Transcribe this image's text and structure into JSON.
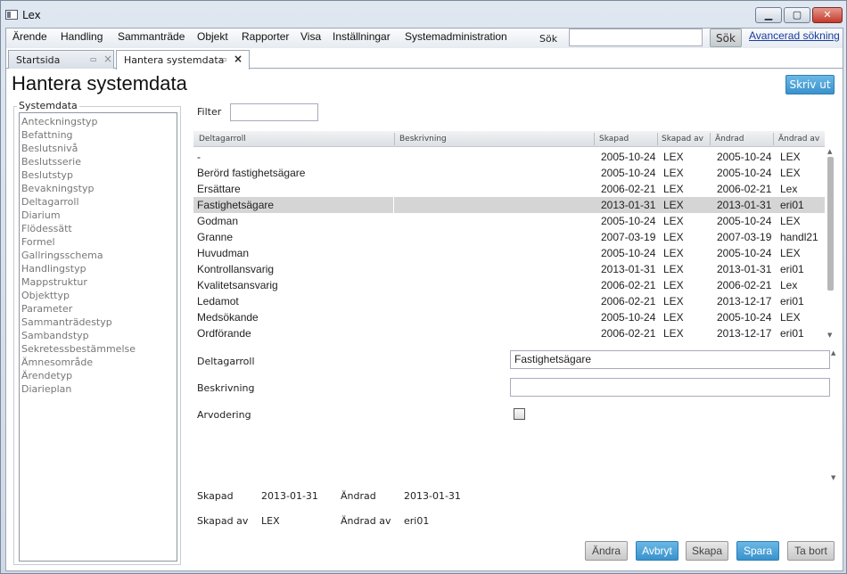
{
  "window": {
    "title": "Lex"
  },
  "menu": [
    "Ärende",
    "Handling",
    "Sammanträde",
    "Objekt",
    "Rapporter",
    "Visa",
    "Inställningar",
    "Systemadministration"
  ],
  "search": {
    "label": "Sök",
    "value": "",
    "button": "Sök",
    "advanced": "Avancerad sökning"
  },
  "tabs": [
    {
      "label": "Startsida"
    },
    {
      "label": "Hantera systemdata"
    }
  ],
  "page": {
    "title": "Hantera systemdata",
    "print": "Skriv ut"
  },
  "sidebar": {
    "title": "Systemdata",
    "items": [
      "Anteckningstyp",
      "Befattning",
      "Beslutsnivå",
      "Beslutsserie",
      "Beslutstyp",
      "Bevakningstyp",
      "Deltagarroll",
      "Diarium",
      "Flödessätt",
      "Formel",
      "Gallringsschema",
      "Handlingstyp",
      "Mappstruktur",
      "Objekttyp",
      "Parameter",
      "Sammanträdestyp",
      "Sambandstyp",
      "Sekretessbestämmelse",
      "Ämnesområde",
      "Ärendetyp",
      "Diarieplan"
    ]
  },
  "filter": {
    "label": "Filter",
    "value": ""
  },
  "table": {
    "columns": [
      "Deltagarroll",
      "Beskrivning",
      "Skapad",
      "Skapad av",
      "Ändrad",
      "Ändrad av"
    ],
    "rows": [
      [
        "-",
        "",
        "2005-10-24",
        "LEX",
        "2005-10-24",
        "LEX"
      ],
      [
        "Berörd fastighetsägare",
        "",
        "2005-10-24",
        "LEX",
        "2005-10-24",
        "LEX"
      ],
      [
        "Ersättare",
        "",
        "2006-02-21",
        "LEX",
        "2006-02-21",
        "Lex"
      ],
      [
        "Fastighetsägare",
        "",
        "2013-01-31",
        "LEX",
        "2013-01-31",
        "eri01"
      ],
      [
        "Godman",
        "",
        "2005-10-24",
        "LEX",
        "2005-10-24",
        "LEX"
      ],
      [
        "Granne",
        "",
        "2007-03-19",
        "LEX",
        "2007-03-19",
        "handl21"
      ],
      [
        "Huvudman",
        "",
        "2005-10-24",
        "LEX",
        "2005-10-24",
        "LEX"
      ],
      [
        "Kontrollansvarig",
        "",
        "2013-01-31",
        "LEX",
        "2013-01-31",
        "eri01"
      ],
      [
        "Kvalitetsansvarig",
        "",
        "2006-02-21",
        "LEX",
        "2006-02-21",
        "Lex"
      ],
      [
        "Ledamot",
        "",
        "2006-02-21",
        "LEX",
        "2013-12-17",
        "eri01"
      ],
      [
        "Medsökande",
        "",
        "2005-10-24",
        "LEX",
        "2005-10-24",
        "LEX"
      ],
      [
        "Ordförande",
        "",
        "2006-02-21",
        "LEX",
        "2013-12-17",
        "eri01"
      ]
    ],
    "selected_index": 3
  },
  "form": {
    "deltagarroll_label": "Deltagarroll",
    "deltagarroll_value": "Fastighetsägare",
    "beskrivning_label": "Beskrivning",
    "beskrivning_value": "",
    "arvodering_label": "Arvodering"
  },
  "meta": {
    "skapad_label": "Skapad",
    "skapad_value": "2013-01-31",
    "andrad_label": "Ändrad",
    "andrad_value": "2013-01-31",
    "skapad_av_label": "Skapad av",
    "skapad_av_value": "LEX",
    "andrad_av_label": "Ändrad av",
    "andrad_av_value": "eri01"
  },
  "buttons": {
    "andra": "Ändra",
    "avbryt": "Avbryt",
    "skapa": "Skapa",
    "spara": "Spara",
    "ta_bort": "Ta bort"
  }
}
